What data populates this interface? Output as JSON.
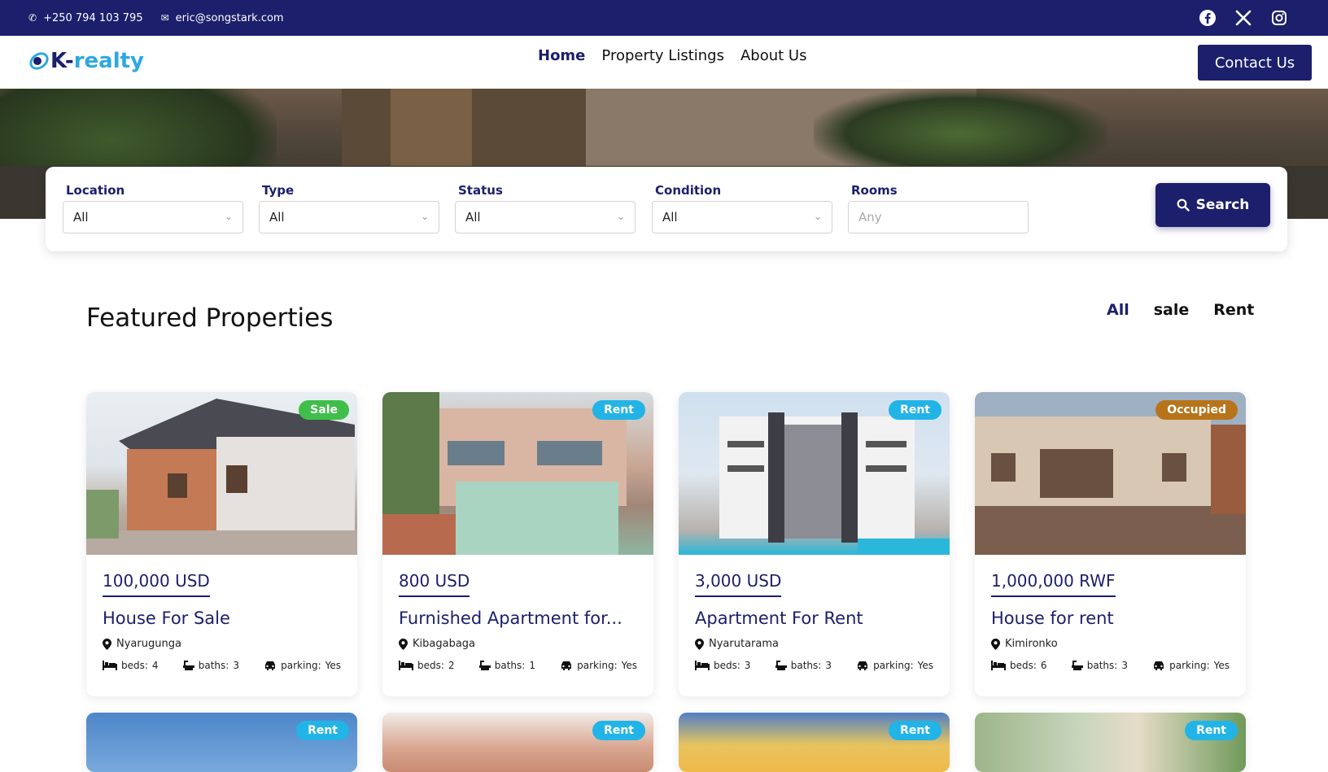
{
  "topbar": {
    "phone": "+250 794 103 795",
    "email": "eric@songstark.com",
    "socials": [
      "facebook-icon",
      "x-icon",
      "instagram-icon"
    ]
  },
  "nav": {
    "logo_k": "K-",
    "logo_realty": "realty",
    "menu": [
      "Home",
      "Property Listings",
      "About Us"
    ],
    "active": "Home",
    "contact_button": "Contact Us"
  },
  "search": {
    "fields": [
      {
        "label": "Location",
        "value": "All"
      },
      {
        "label": "Type",
        "value": "All"
      },
      {
        "label": "Status",
        "value": "All"
      },
      {
        "label": "Condition",
        "value": "All"
      },
      {
        "label": "Rooms",
        "placeholder": "Any"
      }
    ],
    "button": "Search"
  },
  "featured": {
    "title": "Featured Properties",
    "filters": [
      "All",
      "sale",
      "Rent"
    ],
    "active_filter": "All",
    "labels": {
      "beds": "beds:",
      "baths": "baths:",
      "parking": "parking:"
    },
    "cards": [
      {
        "badge": "Sale",
        "badge_color": "#3fbf4a",
        "price": "100,000 USD",
        "title": "House For Sale",
        "location": "Nyarugunga",
        "beds": "4",
        "baths": "3",
        "parking": "Yes"
      },
      {
        "badge": "Rent",
        "badge_color": "#22b4e6",
        "price": "800 USD",
        "title": "Furnished Apartment for...",
        "location": "Kibagabaga",
        "beds": "2",
        "baths": "1",
        "parking": "Yes"
      },
      {
        "badge": "Rent",
        "badge_color": "#22b4e6",
        "price": "3,000 USD",
        "title": "Apartment For Rent",
        "location": "Nyarutarama",
        "beds": "3",
        "baths": "3",
        "parking": "Yes"
      },
      {
        "badge": "Occupied",
        "badge_color": "#b8741a",
        "price": "1,000,000 RWF",
        "title": "House for rent",
        "location": "Kimironko",
        "beds": "6",
        "baths": "3",
        "parking": "Yes"
      }
    ],
    "row2_badges": [
      "Rent",
      "Rent",
      "Rent",
      "Rent"
    ]
  }
}
